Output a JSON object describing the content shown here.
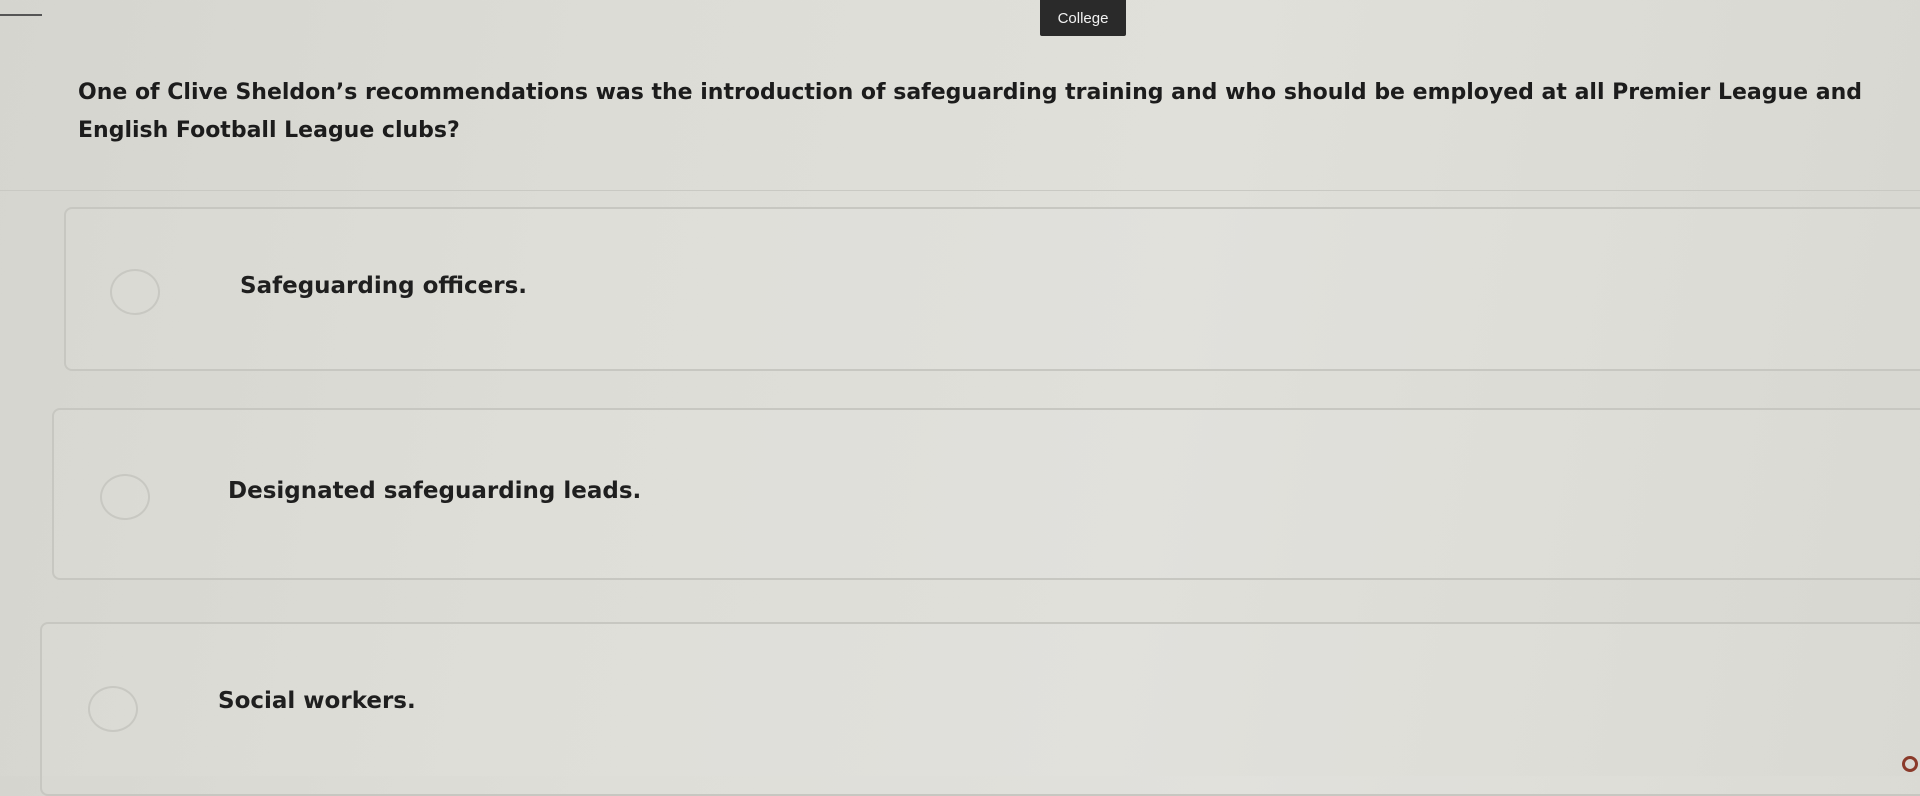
{
  "header": {
    "brand_label": "College"
  },
  "quiz": {
    "question": "One of Clive Sheldon’s recommendations was the introduction of safeguarding training and who should be employed at all Premier League and English Football League clubs?",
    "options": [
      {
        "label": "Safeguarding officers."
      },
      {
        "label": "Designated safeguarding leads."
      },
      {
        "label": "Social workers."
      }
    ]
  },
  "icons": {
    "corner": "status-circle-icon"
  },
  "colors": {
    "background": "#dcdcd6",
    "badge": "#2a2a2a",
    "option_border": "#c7c7c1"
  }
}
